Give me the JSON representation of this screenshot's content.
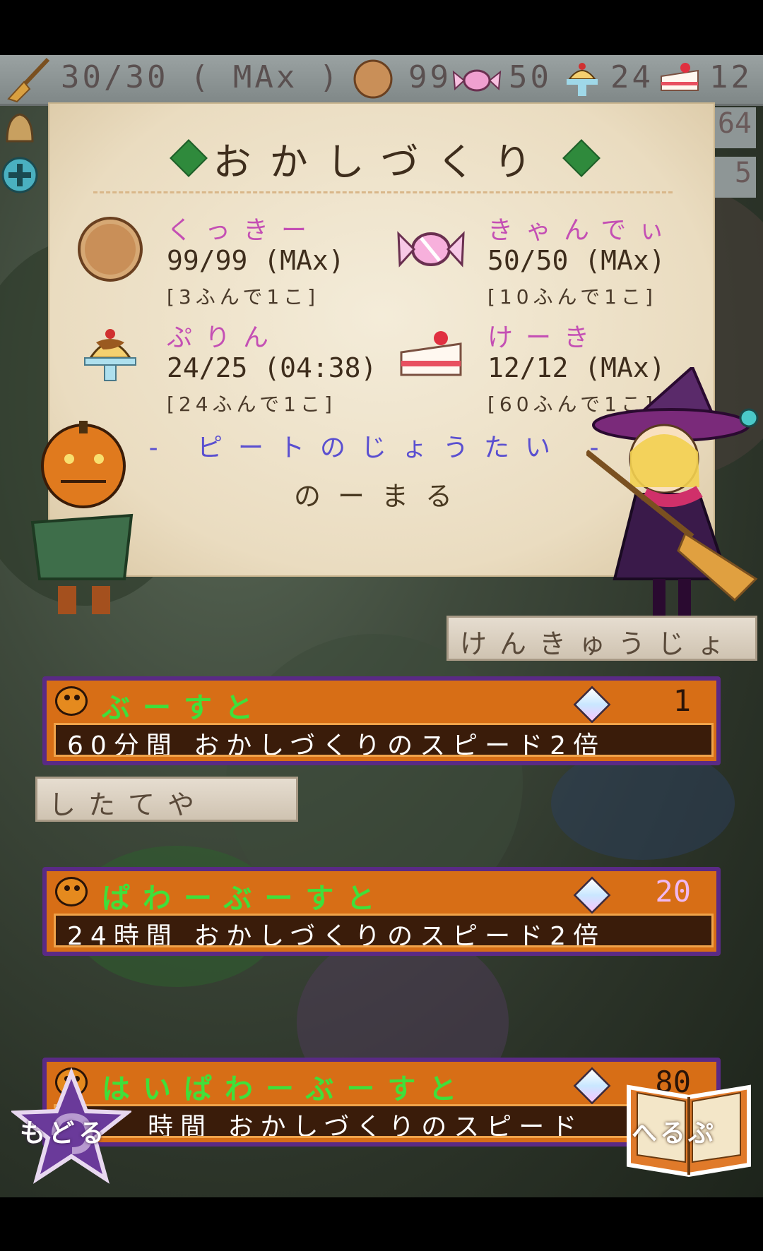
{
  "topbar": {
    "stamina": "30/30 ( MAx )",
    "cookie_count": "99",
    "candy_count": "50",
    "pudding_count": "24",
    "cake_count": "12",
    "side_value_1": "64",
    "side_value_2": "5"
  },
  "panel": {
    "title": "おかしづくり",
    "items": [
      {
        "name": "くっきー",
        "amount": "99/99 (MAx)",
        "rate": "[3ふんで1こ]",
        "icon": "cookie-icon"
      },
      {
        "name": "きゃんでぃ",
        "amount": "50/50 (MAx)",
        "rate": "[10ふんで1こ]",
        "icon": "candy-icon"
      },
      {
        "name": "ぷりん",
        "amount": "24/25 (04:38)",
        "rate": "[24ふんで1こ]",
        "icon": "pudding-icon"
      },
      {
        "name": "けーき",
        "amount": "12/12 (MAx)",
        "rate": "[60ふんで1こ]",
        "icon": "cake-icon"
      }
    ],
    "pete_label": "- ピートのじょうたい -",
    "pete_status": "のーまる"
  },
  "signs": {
    "lab": "けんきゅうじょ",
    "tailor": "したてや"
  },
  "boosts": [
    {
      "title": "ぶーすと",
      "cost": "1",
      "desc": "60分間 おかしづくりのスピード2倍"
    },
    {
      "title": "ぱわーぶーすと",
      "cost": "20",
      "desc": "24時間 おかしづくりのスピード2倍"
    },
    {
      "title": "はいぱわーぶーすと",
      "cost": "80",
      "desc": "時間 おかしづくりのスピード"
    }
  ],
  "buttons": {
    "back": "もどる",
    "help": "へるぷ"
  },
  "colors": {
    "item_name": "#c44fb4",
    "boost_bg": "#d76e16",
    "boost_border": "#5a2a85",
    "boost_title": "#3fe03a",
    "title_diamond": "#2f8a3c"
  }
}
